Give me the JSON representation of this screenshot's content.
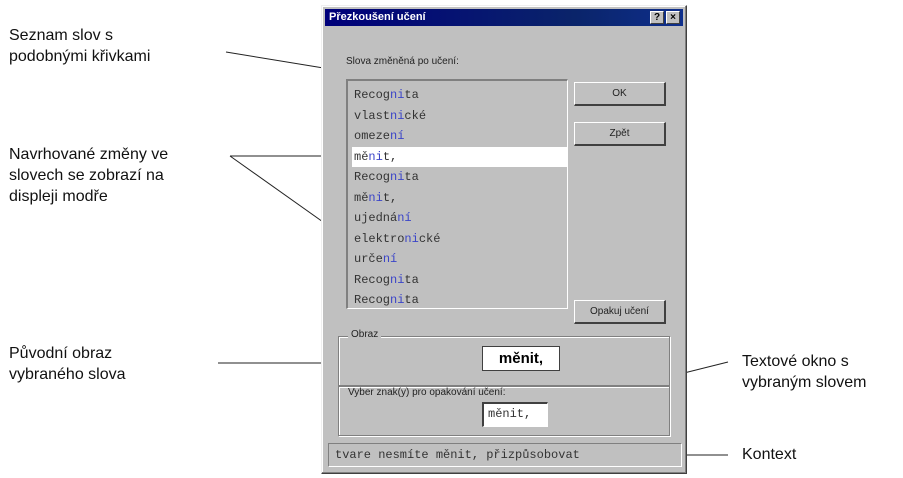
{
  "callouts": {
    "word_list": "Seznam slov s\npodobnými křivkami",
    "proposed_changes": "Navrhované změny ve\nslovech se zobrazí na\ndispleji modře",
    "original_image": "Původní obraz\nvybraného slova",
    "text_box": "Textové okno s\nvybraným slovem",
    "context": "Kontext"
  },
  "dialog": {
    "title": "Přezkoušení učení",
    "help_button": "?",
    "close_button": "×",
    "list_label": "Slova změněná po učení:",
    "list_items": [
      {
        "prefix": "Recog",
        "highlight": "ni",
        "suffix": "ta"
      },
      {
        "prefix": "vlast",
        "highlight": "ni",
        "suffix": "cké"
      },
      {
        "prefix": "omeze",
        "highlight": "ní",
        "suffix": ""
      },
      {
        "prefix": "mě",
        "highlight": "ni",
        "suffix": "t,"
      },
      {
        "prefix": "Recog",
        "highlight": "ni",
        "suffix": "ta"
      },
      {
        "prefix": "mě",
        "highlight": "ni",
        "suffix": "t,"
      },
      {
        "prefix": "ujedná",
        "highlight": "ní",
        "suffix": ""
      },
      {
        "prefix": "elektro",
        "highlight": "ni",
        "suffix": "cké"
      },
      {
        "prefix": "urče",
        "highlight": "ní",
        "suffix": ""
      },
      {
        "prefix": "Recog",
        "highlight": "ni",
        "suffix": "ta"
      },
      {
        "prefix": "Recog",
        "highlight": "ni",
        "suffix": "ta"
      }
    ],
    "selected_index": 3,
    "ok_button": "OK",
    "back_button": "Zpět",
    "repeat_button": "Opakuj učení",
    "image_label": "Obraz",
    "image_word": "měnit,",
    "chars_label": "Vyber znak(y) pro opakování učení:",
    "chars_value": "měnit,",
    "context": "tvare nesmíte měnit, přizpůsobovat"
  },
  "colors": {
    "highlight": "#3b45c8",
    "titlebar": "#0a246a",
    "dialog_face": "#c0c0c0"
  }
}
